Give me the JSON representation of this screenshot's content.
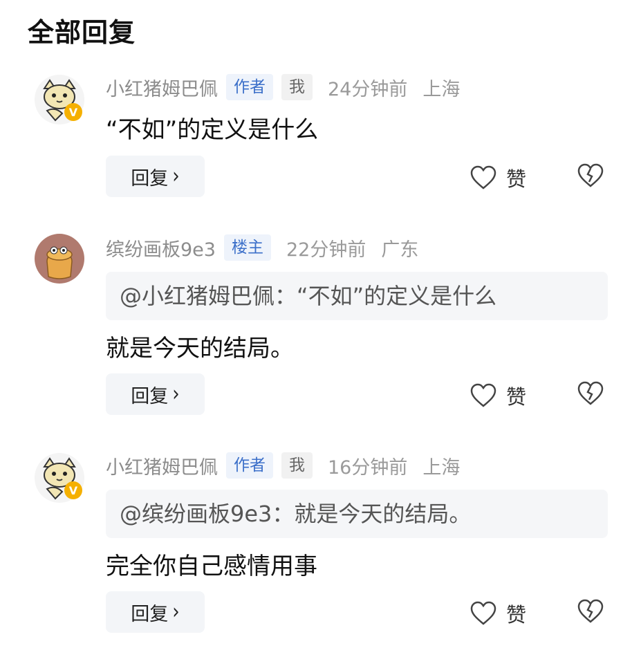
{
  "page_title": "全部回复",
  "comments": [
    {
      "username": "小红猪姆巴佩",
      "badges": [
        "作者",
        "我"
      ],
      "time": "24分钟前",
      "location": "上海",
      "quote": "",
      "content": "“不如”的定义是什么",
      "reply_label": "回复",
      "like_label": "赞"
    },
    {
      "username": "缤纷画板9e3",
      "badges": [
        "楼主"
      ],
      "time": "22分钟前",
      "location": "广东",
      "quote": "@小红猪姆巴佩：“不如”的定义是什么",
      "content": "就是今天的结局。",
      "reply_label": "回复",
      "like_label": "赞"
    },
    {
      "username": "小红猪姆巴佩",
      "badges": [
        "作者",
        "我"
      ],
      "time": "16分钟前",
      "location": "上海",
      "quote": "@缤纷画板9e3：就是今天的结局。",
      "content": "完全你自己感情用事",
      "reply_label": "回复",
      "like_label": "赞"
    }
  ],
  "icons": {
    "avatar_1": "cat-avatar-icon",
    "verified": "verified-v-badge-icon",
    "avatar_2": "bread-avatar-icon",
    "like": "heart-outline-icon",
    "dislike": "broken-heart-icon",
    "chevron": "chevron-right-icon"
  },
  "colors": {
    "badge_text": "#3b6fc9",
    "badge_bg": "#eef3fb",
    "verified": "#f5b000",
    "meta_text": "#9a9a9a"
  }
}
